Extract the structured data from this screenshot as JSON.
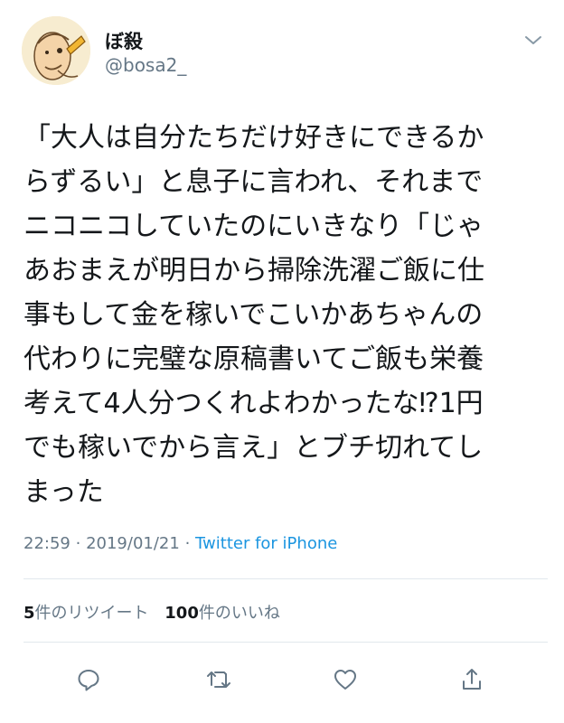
{
  "user": {
    "display_name": "ぼ殺",
    "handle": "@bosa2_"
  },
  "tweet": {
    "lines": [
      "「大人は自分たちだけ好きにできるか",
      "らずるい」と息子に言われ、それまで",
      "ニコニコしていたのにいきなり「じゃ",
      "あおまえが明日から掃除洗濯ご飯に仕",
      "事もして金を稼いでこいかあちゃんの",
      "代わりに完璧な原稿書いてご飯も栄養",
      "考えて4人分つくれよわかったな⁉1円",
      "でも稼いでから言え」とブチ切れてし",
      "まった"
    ],
    "time": "22:59",
    "date": "2019/01/21",
    "separator": "·",
    "source": "Twitter for iPhone"
  },
  "stats": {
    "retweet_count": "5",
    "retweet_label": "件のリツイート",
    "like_count": "100",
    "like_label": "件のいいね"
  },
  "icons": {
    "menu": "chevron-down-icon",
    "reply": "reply-icon",
    "retweet": "retweet-icon",
    "like": "heart-icon",
    "share": "share-icon"
  },
  "colors": {
    "text": "#14171a",
    "secondary": "#657786",
    "link": "#1b95e0",
    "divider": "#e1e8ed"
  }
}
